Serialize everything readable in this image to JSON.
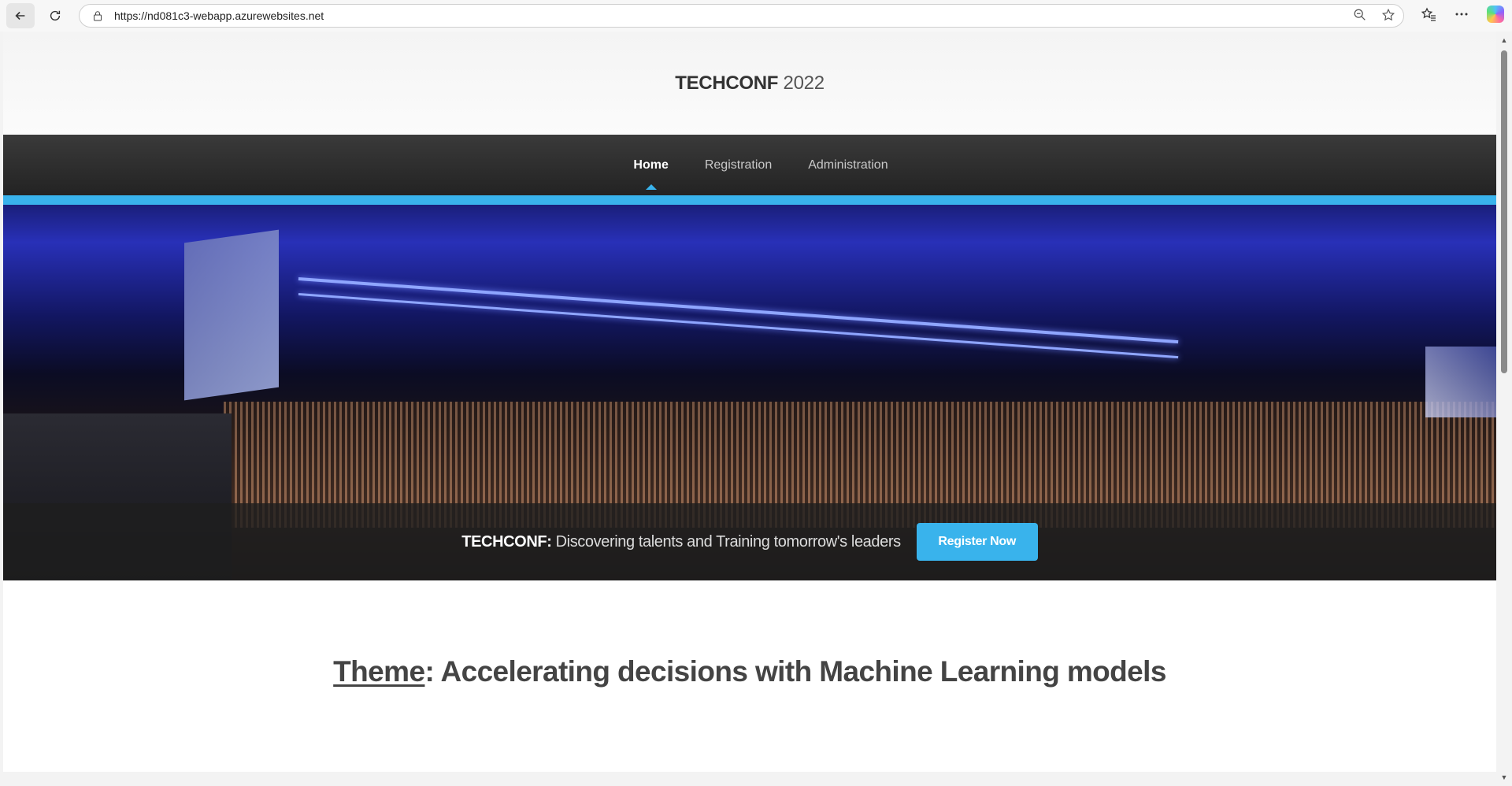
{
  "browser": {
    "url": "https://nd081c3-webapp.azurewebsites.net"
  },
  "site": {
    "brand_bold": "TECHCONF",
    "brand_year": "2022"
  },
  "nav": {
    "items": [
      {
        "label": "Home",
        "active": true
      },
      {
        "label": "Registration",
        "active": false
      },
      {
        "label": "Administration",
        "active": false
      }
    ]
  },
  "hero": {
    "tagline_bold": "TECHCONF:",
    "tagline_text": " Discovering talents and Training tomorrow's leaders",
    "register_label": "Register Now"
  },
  "theme": {
    "label": "Theme",
    "text": ": Accelerating decisions with Machine Learning models"
  },
  "colors": {
    "accent": "#39b3ec",
    "navbar": "#2b2b2b"
  }
}
